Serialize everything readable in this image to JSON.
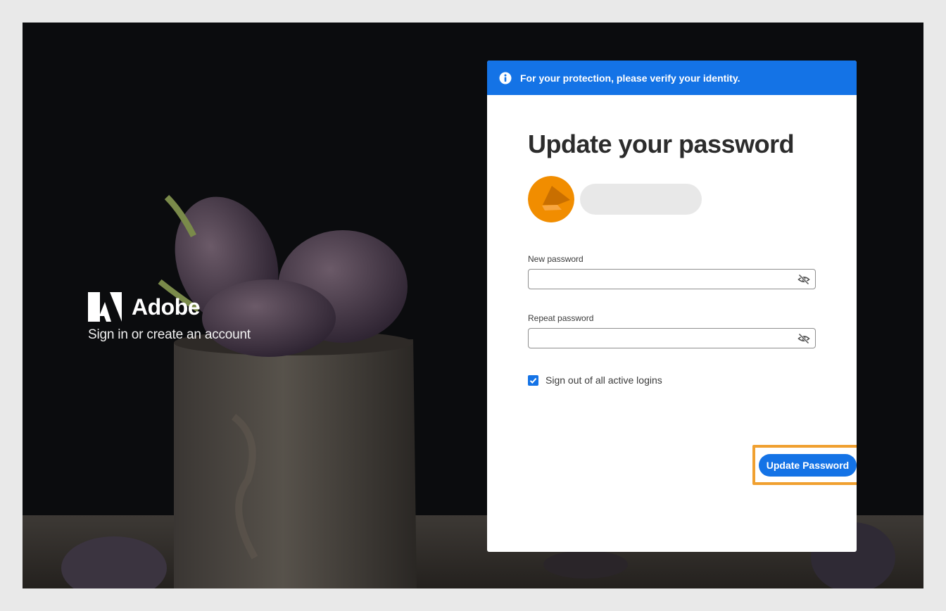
{
  "brand": {
    "name": "Adobe",
    "tagline": "Sign in or create an account",
    "logo_icon": "adobe-logo-icon"
  },
  "notice": {
    "icon": "info-icon",
    "text": "For your protection, please verify your identity.",
    "color": "#1473e6"
  },
  "form": {
    "title": "Update your password",
    "avatar_icon": "avatar-icon",
    "avatar_color": "#f18d00",
    "new_password": {
      "label": "New password",
      "value": "",
      "toggle_icon": "eye-slash-icon"
    },
    "repeat_password": {
      "label": "Repeat password",
      "value": "",
      "toggle_icon": "eye-slash-icon"
    },
    "sign_out_all": {
      "label": "Sign out of all active logins",
      "checked": true
    },
    "submit_label": "Update Password",
    "highlight_color": "#f0a030"
  }
}
